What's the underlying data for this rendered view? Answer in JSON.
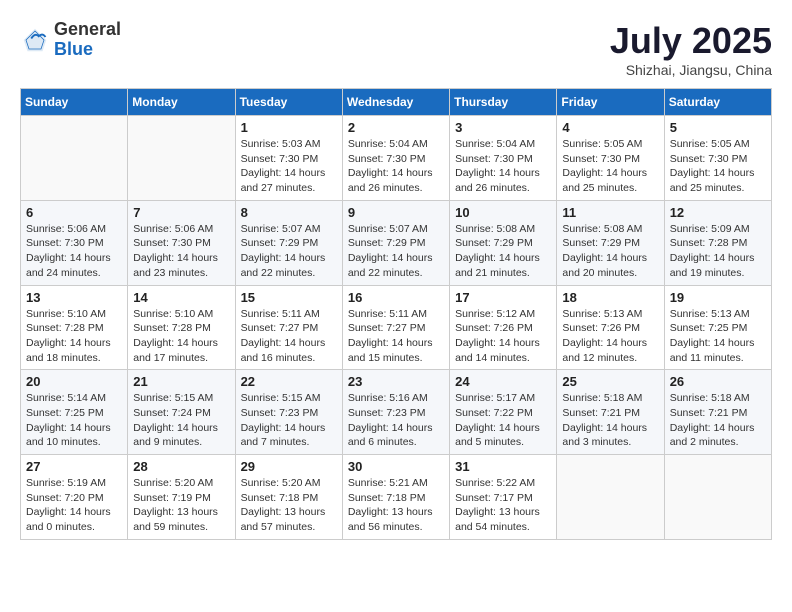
{
  "header": {
    "logo_general": "General",
    "logo_blue": "Blue",
    "month_title": "July 2025",
    "location": "Shizhai, Jiangsu, China"
  },
  "days_of_week": [
    "Sunday",
    "Monday",
    "Tuesday",
    "Wednesday",
    "Thursday",
    "Friday",
    "Saturday"
  ],
  "weeks": [
    [
      {
        "day": "",
        "sunrise": "",
        "sunset": "",
        "daylight": ""
      },
      {
        "day": "",
        "sunrise": "",
        "sunset": "",
        "daylight": ""
      },
      {
        "day": "1",
        "sunrise": "Sunrise: 5:03 AM",
        "sunset": "Sunset: 7:30 PM",
        "daylight": "Daylight: 14 hours and 27 minutes."
      },
      {
        "day": "2",
        "sunrise": "Sunrise: 5:04 AM",
        "sunset": "Sunset: 7:30 PM",
        "daylight": "Daylight: 14 hours and 26 minutes."
      },
      {
        "day": "3",
        "sunrise": "Sunrise: 5:04 AM",
        "sunset": "Sunset: 7:30 PM",
        "daylight": "Daylight: 14 hours and 26 minutes."
      },
      {
        "day": "4",
        "sunrise": "Sunrise: 5:05 AM",
        "sunset": "Sunset: 7:30 PM",
        "daylight": "Daylight: 14 hours and 25 minutes."
      },
      {
        "day": "5",
        "sunrise": "Sunrise: 5:05 AM",
        "sunset": "Sunset: 7:30 PM",
        "daylight": "Daylight: 14 hours and 25 minutes."
      }
    ],
    [
      {
        "day": "6",
        "sunrise": "Sunrise: 5:06 AM",
        "sunset": "Sunset: 7:30 PM",
        "daylight": "Daylight: 14 hours and 24 minutes."
      },
      {
        "day": "7",
        "sunrise": "Sunrise: 5:06 AM",
        "sunset": "Sunset: 7:30 PM",
        "daylight": "Daylight: 14 hours and 23 minutes."
      },
      {
        "day": "8",
        "sunrise": "Sunrise: 5:07 AM",
        "sunset": "Sunset: 7:29 PM",
        "daylight": "Daylight: 14 hours and 22 minutes."
      },
      {
        "day": "9",
        "sunrise": "Sunrise: 5:07 AM",
        "sunset": "Sunset: 7:29 PM",
        "daylight": "Daylight: 14 hours and 22 minutes."
      },
      {
        "day": "10",
        "sunrise": "Sunrise: 5:08 AM",
        "sunset": "Sunset: 7:29 PM",
        "daylight": "Daylight: 14 hours and 21 minutes."
      },
      {
        "day": "11",
        "sunrise": "Sunrise: 5:08 AM",
        "sunset": "Sunset: 7:29 PM",
        "daylight": "Daylight: 14 hours and 20 minutes."
      },
      {
        "day": "12",
        "sunrise": "Sunrise: 5:09 AM",
        "sunset": "Sunset: 7:28 PM",
        "daylight": "Daylight: 14 hours and 19 minutes."
      }
    ],
    [
      {
        "day": "13",
        "sunrise": "Sunrise: 5:10 AM",
        "sunset": "Sunset: 7:28 PM",
        "daylight": "Daylight: 14 hours and 18 minutes."
      },
      {
        "day": "14",
        "sunrise": "Sunrise: 5:10 AM",
        "sunset": "Sunset: 7:28 PM",
        "daylight": "Daylight: 14 hours and 17 minutes."
      },
      {
        "day": "15",
        "sunrise": "Sunrise: 5:11 AM",
        "sunset": "Sunset: 7:27 PM",
        "daylight": "Daylight: 14 hours and 16 minutes."
      },
      {
        "day": "16",
        "sunrise": "Sunrise: 5:11 AM",
        "sunset": "Sunset: 7:27 PM",
        "daylight": "Daylight: 14 hours and 15 minutes."
      },
      {
        "day": "17",
        "sunrise": "Sunrise: 5:12 AM",
        "sunset": "Sunset: 7:26 PM",
        "daylight": "Daylight: 14 hours and 14 minutes."
      },
      {
        "day": "18",
        "sunrise": "Sunrise: 5:13 AM",
        "sunset": "Sunset: 7:26 PM",
        "daylight": "Daylight: 14 hours and 12 minutes."
      },
      {
        "day": "19",
        "sunrise": "Sunrise: 5:13 AM",
        "sunset": "Sunset: 7:25 PM",
        "daylight": "Daylight: 14 hours and 11 minutes."
      }
    ],
    [
      {
        "day": "20",
        "sunrise": "Sunrise: 5:14 AM",
        "sunset": "Sunset: 7:25 PM",
        "daylight": "Daylight: 14 hours and 10 minutes."
      },
      {
        "day": "21",
        "sunrise": "Sunrise: 5:15 AM",
        "sunset": "Sunset: 7:24 PM",
        "daylight": "Daylight: 14 hours and 9 minutes."
      },
      {
        "day": "22",
        "sunrise": "Sunrise: 5:15 AM",
        "sunset": "Sunset: 7:23 PM",
        "daylight": "Daylight: 14 hours and 7 minutes."
      },
      {
        "day": "23",
        "sunrise": "Sunrise: 5:16 AM",
        "sunset": "Sunset: 7:23 PM",
        "daylight": "Daylight: 14 hours and 6 minutes."
      },
      {
        "day": "24",
        "sunrise": "Sunrise: 5:17 AM",
        "sunset": "Sunset: 7:22 PM",
        "daylight": "Daylight: 14 hours and 5 minutes."
      },
      {
        "day": "25",
        "sunrise": "Sunrise: 5:18 AM",
        "sunset": "Sunset: 7:21 PM",
        "daylight": "Daylight: 14 hours and 3 minutes."
      },
      {
        "day": "26",
        "sunrise": "Sunrise: 5:18 AM",
        "sunset": "Sunset: 7:21 PM",
        "daylight": "Daylight: 14 hours and 2 minutes."
      }
    ],
    [
      {
        "day": "27",
        "sunrise": "Sunrise: 5:19 AM",
        "sunset": "Sunset: 7:20 PM",
        "daylight": "Daylight: 14 hours and 0 minutes."
      },
      {
        "day": "28",
        "sunrise": "Sunrise: 5:20 AM",
        "sunset": "Sunset: 7:19 PM",
        "daylight": "Daylight: 13 hours and 59 minutes."
      },
      {
        "day": "29",
        "sunrise": "Sunrise: 5:20 AM",
        "sunset": "Sunset: 7:18 PM",
        "daylight": "Daylight: 13 hours and 57 minutes."
      },
      {
        "day": "30",
        "sunrise": "Sunrise: 5:21 AM",
        "sunset": "Sunset: 7:18 PM",
        "daylight": "Daylight: 13 hours and 56 minutes."
      },
      {
        "day": "31",
        "sunrise": "Sunrise: 5:22 AM",
        "sunset": "Sunset: 7:17 PM",
        "daylight": "Daylight: 13 hours and 54 minutes."
      },
      {
        "day": "",
        "sunrise": "",
        "sunset": "",
        "daylight": ""
      },
      {
        "day": "",
        "sunrise": "",
        "sunset": "",
        "daylight": ""
      }
    ]
  ]
}
